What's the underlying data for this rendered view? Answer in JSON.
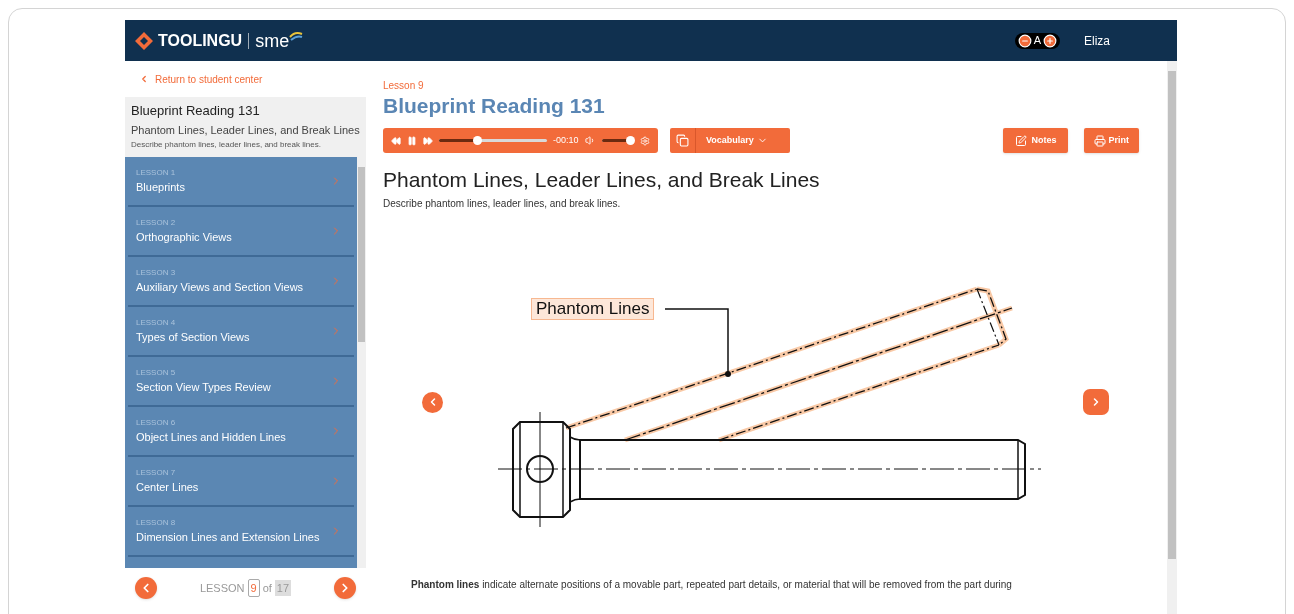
{
  "header": {
    "logo": "TOOLING**U**",
    "partner": "sme",
    "font_size_label": "A",
    "user": "Eliza"
  },
  "sidebar": {
    "back_link": "Return to student center",
    "course": "Blueprint Reading 131",
    "lesson_title": "Phantom Lines, Leader Lines, and Break Lines",
    "lesson_description": "Describe phantom lines, leader lines, and break lines.",
    "lessons": [
      {
        "number": "LESSON 1",
        "title": "Blueprints",
        "selected": false
      },
      {
        "number": "LESSON 2",
        "title": "Orthographic Views",
        "selected": false
      },
      {
        "number": "LESSON 3",
        "title": "Auxiliary Views and Section Views",
        "selected": false
      },
      {
        "number": "LESSON 4",
        "title": "Types of Section Views",
        "selected": false
      },
      {
        "number": "LESSON 5",
        "title": "Section View Types Review",
        "selected": false
      },
      {
        "number": "LESSON 6",
        "title": "Object Lines and Hidden Lines",
        "selected": false
      },
      {
        "number": "LESSON 7",
        "title": "Center Lines",
        "selected": false
      },
      {
        "number": "LESSON 8",
        "title": "Dimension Lines and Extension Lines",
        "selected": false
      }
    ],
    "pager": {
      "label": "LESSON",
      "current": "9",
      "of": "of",
      "total": "17"
    }
  },
  "main": {
    "lesson_label": "Lesson 9",
    "course_title": "Blueprint Reading 131",
    "audio": {
      "progress": {
        "level": 0.35
      },
      "time": "-00:10",
      "volume": {
        "level": 1
      }
    },
    "vocabulary_button": "Vocabulary",
    "notes_button": "Notes",
    "print_button": "Print",
    "heading": "Phantom Lines, Leader Lines, and Break Lines",
    "description": "Describe phantom lines, leader lines, and break lines.",
    "diagram": {
      "callout": "Phantom Lines"
    },
    "paragraph": "**Phantom lines** indicate alternate positions of a movable part, repeated part details, or material that will be removed from the part during"
  }
}
